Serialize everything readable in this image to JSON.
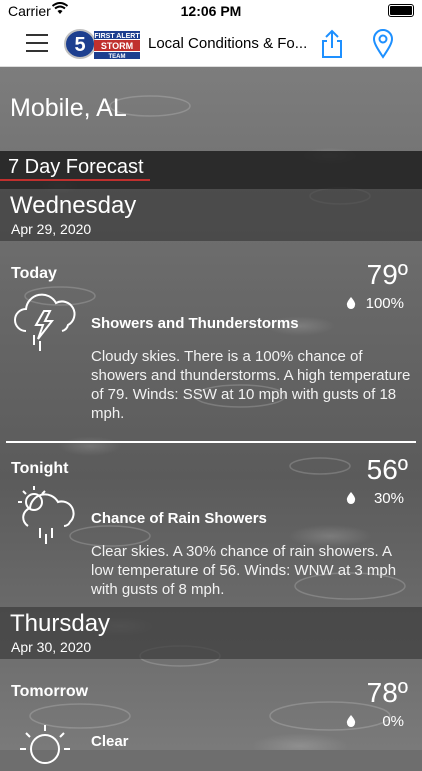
{
  "status": {
    "carrier": "Carrier",
    "time": "12:06 PM"
  },
  "nav": {
    "title": "Local Conditions & Fo..."
  },
  "location": "Mobile, AL",
  "section_title": "7 Day Forecast",
  "days": [
    {
      "day": "Wednesday",
      "date": "Apr 29, 2020",
      "periods": [
        {
          "name": "Today",
          "temp": "79º",
          "precip": "100%",
          "condition": "Showers and Thunderstorms",
          "icon": "thunderstorm-icon",
          "description": "Cloudy skies. There is a 100% chance of showers and thunderstorms.  A high temperature of 79.  Winds: SSW at 10 mph with gusts of 18 mph."
        },
        {
          "name": "Tonight",
          "temp": "56º",
          "precip": "30%",
          "condition": "Chance of Rain Showers",
          "icon": "rain-showers-icon",
          "description": "Clear skies.  A 30% chance of rain showers.  A low temperature of 56.  Winds: WNW at 3 mph with gusts of 8 mph."
        }
      ]
    },
    {
      "day": "Thursday",
      "date": "Apr 30, 2020",
      "periods": [
        {
          "name": "Tomorrow",
          "temp": "78º",
          "precip": "0%",
          "condition": "Clear",
          "icon": "sun-icon"
        }
      ]
    }
  ],
  "colors": {
    "accent": "#c0302e",
    "nav_icon": "#1e90ff"
  }
}
